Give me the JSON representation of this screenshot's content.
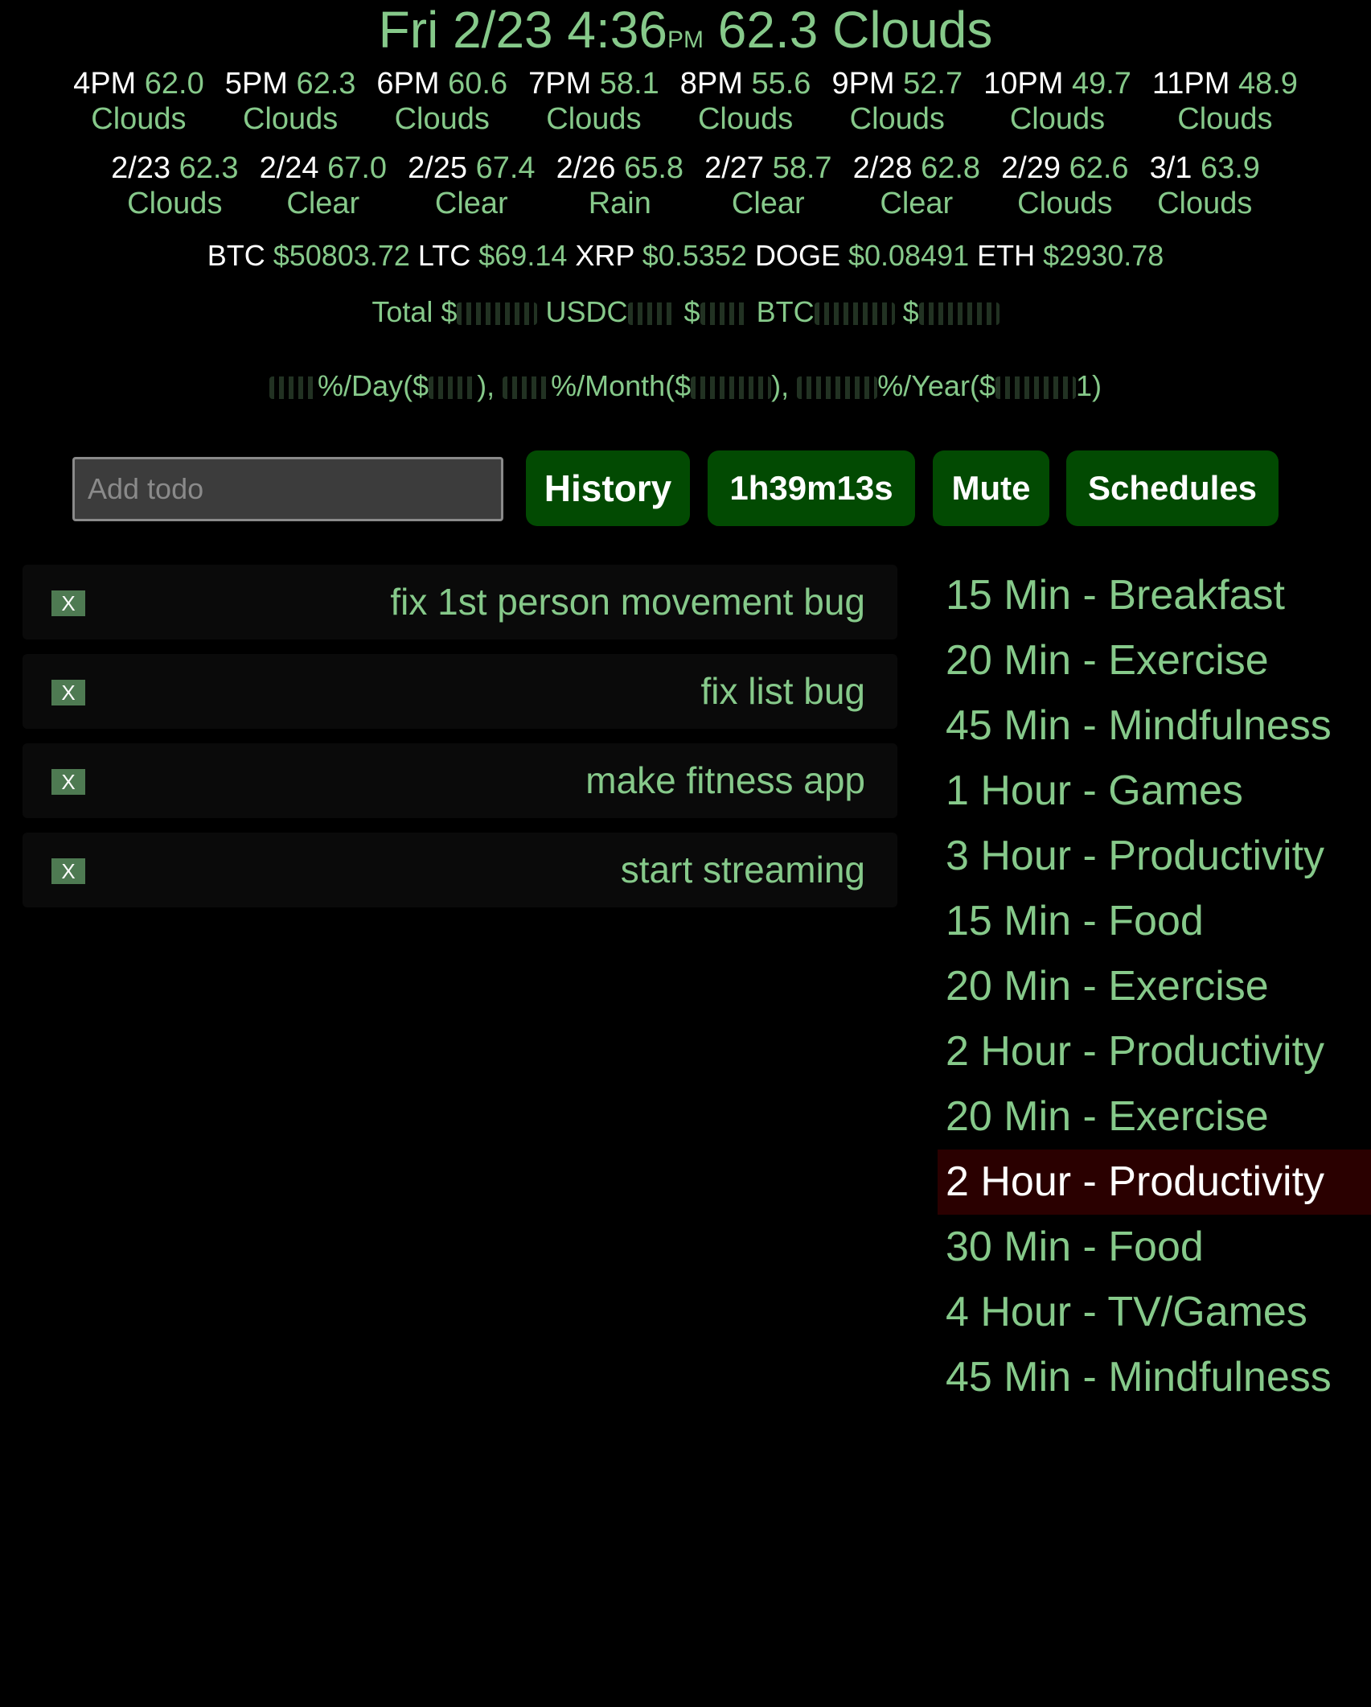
{
  "header": {
    "day": "Fri",
    "date": "2/23",
    "time": "4:36",
    "ampm": "PM",
    "temp": "62.3",
    "condition": "Clouds"
  },
  "hourly": [
    {
      "label": "4PM",
      "temp": "62.0",
      "condition": "Clouds"
    },
    {
      "label": "5PM",
      "temp": "62.3",
      "condition": "Clouds"
    },
    {
      "label": "6PM",
      "temp": "60.6",
      "condition": "Clouds"
    },
    {
      "label": "7PM",
      "temp": "58.1",
      "condition": "Clouds"
    },
    {
      "label": "8PM",
      "temp": "55.6",
      "condition": "Clouds"
    },
    {
      "label": "9PM",
      "temp": "52.7",
      "condition": "Clouds"
    },
    {
      "label": "10PM",
      "temp": "49.7",
      "condition": "Clouds"
    },
    {
      "label": "11PM",
      "temp": "48.9",
      "condition": "Clouds"
    }
  ],
  "daily": [
    {
      "label": "2/23",
      "temp": "62.3",
      "condition": "Clouds"
    },
    {
      "label": "2/24",
      "temp": "67.0",
      "condition": "Clear"
    },
    {
      "label": "2/25",
      "temp": "67.4",
      "condition": "Clear"
    },
    {
      "label": "2/26",
      "temp": "65.8",
      "condition": "Rain"
    },
    {
      "label": "2/27",
      "temp": "58.7",
      "condition": "Clear"
    },
    {
      "label": "2/28",
      "temp": "62.8",
      "condition": "Clear"
    },
    {
      "label": "2/29",
      "temp": "62.6",
      "condition": "Clouds"
    },
    {
      "label": "3/1",
      "temp": "63.9",
      "condition": "Clouds"
    }
  ],
  "crypto": [
    {
      "symbol": "BTC",
      "price": "$50803.72"
    },
    {
      "symbol": "LTC",
      "price": "$69.14"
    },
    {
      "symbol": "XRP",
      "price": "$0.5352"
    },
    {
      "symbol": "DOGE",
      "price": "$0.08491"
    },
    {
      "symbol": "ETH",
      "price": "$2930.78"
    }
  ],
  "portfolio": {
    "total_label": "Total $",
    "usdc_label": "USDC",
    "usdc_dollar": "$",
    "btc_label": "BTC",
    "btc_dollar": "$"
  },
  "returns": {
    "day_label": "%/Day($",
    "day_close": "),",
    "month_label": "%/Month($",
    "month_close": "),",
    "year_label": "%/Year($",
    "year_close": "1)"
  },
  "controls": {
    "todo_placeholder": "Add todo",
    "history_label": "History",
    "timer_label": "1h39m13s",
    "mute_label": "Mute",
    "schedules_label": "Schedules"
  },
  "todos": [
    {
      "remove_label": "X",
      "text": "fix 1st person movement bug"
    },
    {
      "remove_label": "X",
      "text": "fix list bug"
    },
    {
      "remove_label": "X",
      "text": "make fitness app"
    },
    {
      "remove_label": "X",
      "text": "start streaming"
    }
  ],
  "schedule": [
    {
      "text": "15 Min - Breakfast",
      "active": false
    },
    {
      "text": "20 Min - Exercise",
      "active": false
    },
    {
      "text": "45 Min - Mindfulness",
      "active": false
    },
    {
      "text": "1 Hour - Games",
      "active": false
    },
    {
      "text": "3 Hour - Productivity",
      "active": false
    },
    {
      "text": "15 Min - Food",
      "active": false
    },
    {
      "text": "20 Min - Exercise",
      "active": false
    },
    {
      "text": "2 Hour - Productivity",
      "active": false
    },
    {
      "text": "20 Min - Exercise",
      "active": false
    },
    {
      "text": "2 Hour - Productivity",
      "active": true
    },
    {
      "text": "30 Min - Food",
      "active": false
    },
    {
      "text": "4 Hour - TV/Games",
      "active": false
    },
    {
      "text": "45 Min - Mindfulness",
      "active": false
    }
  ],
  "colors": {
    "background": "#000000",
    "accent_green": "#86c98a",
    "button_bg": "#024a02",
    "active_schedule_bg": "#2a0000"
  }
}
